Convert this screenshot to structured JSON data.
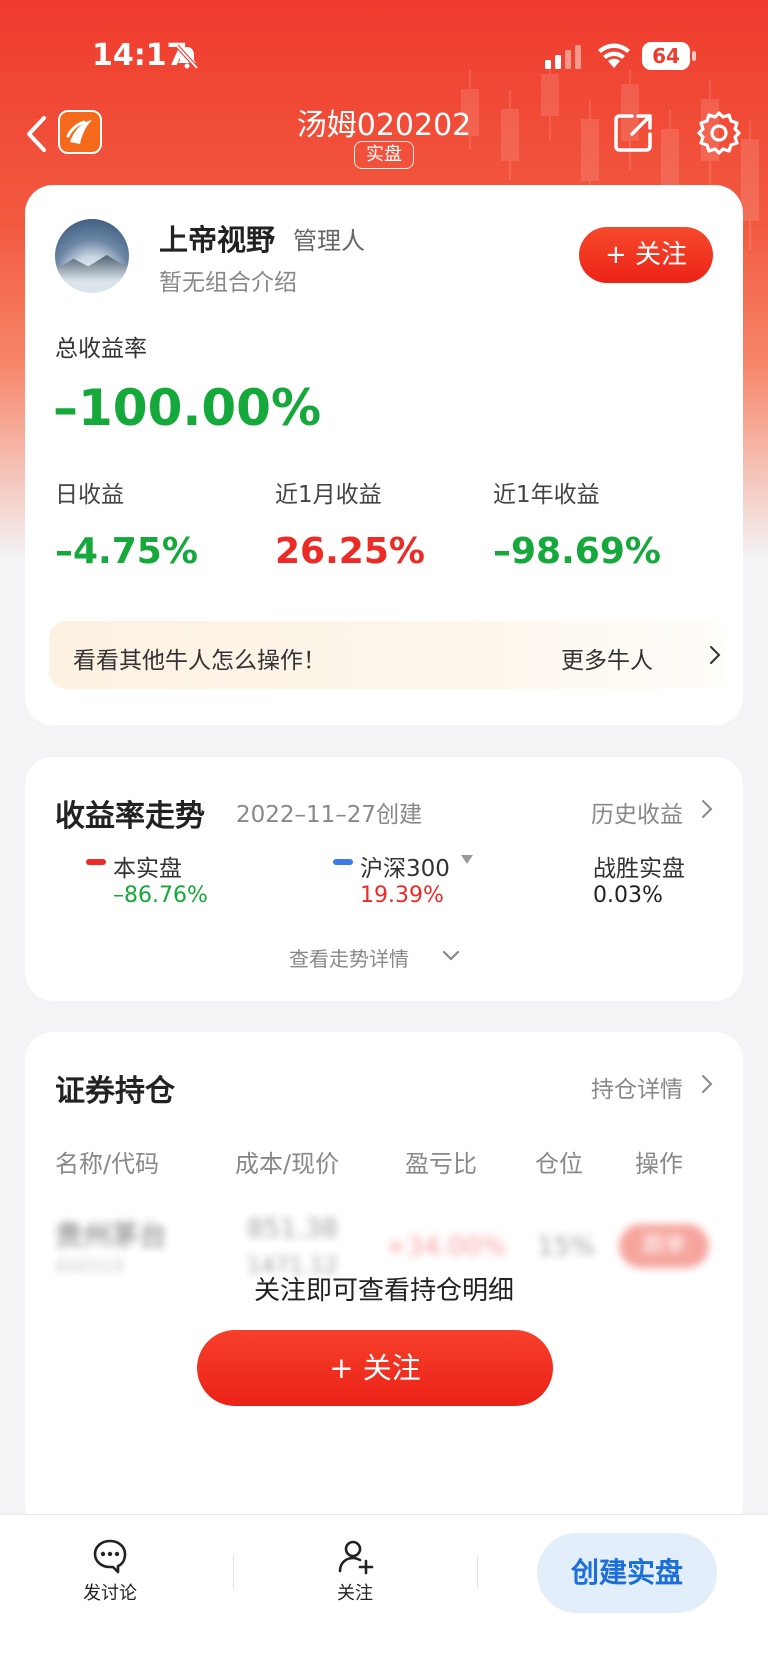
{
  "status_bar": {
    "time": "14:17",
    "battery": "64"
  },
  "nav": {
    "title": "汤姆020202",
    "tag": "实盘"
  },
  "profile": {
    "name": "上帝视野",
    "role": "管理人",
    "description": "暂无组合介绍",
    "follow_label": "+ 关注",
    "total_return_label": "总收益率",
    "total_return_value": "–100.00%",
    "stats": [
      {
        "label": "日收益",
        "value": "–4.75%"
      },
      {
        "label": "近1月收益",
        "value": "26.25%"
      },
      {
        "label": "近1年收益",
        "value": "–98.69%"
      }
    ],
    "promo_text": "看看其他牛人怎么操作！",
    "promo_more": "更多牛人"
  },
  "trend": {
    "title": "收益率走势",
    "created": "2022–11–27创建",
    "history_link": "历史收益",
    "legend": [
      {
        "name": "本实盘",
        "value": "–86.76%",
        "color": "#ec2b26"
      },
      {
        "name": "沪深300",
        "value": "19.39%",
        "color": "#3b7be8"
      },
      {
        "name": "战胜实盘",
        "value": "0.03%"
      }
    ],
    "detail_link": "查看走势详情"
  },
  "holdings": {
    "title": "证券持仓",
    "detail_link": "持仓详情",
    "columns": [
      "名称/代码",
      "成本/现价",
      "盈亏比",
      "仓位",
      "操作"
    ],
    "blurred_row": {
      "name": "贵州茅台",
      "code": "600519",
      "cost": "851.38",
      "price": "1471.12",
      "ratio": "+34.00%",
      "position": "15%",
      "action": "跟单"
    },
    "notice": "关注即可查看持仓明细",
    "follow_label": "+ 关注"
  },
  "bottom_bar": {
    "discuss_label": "发讨论",
    "follow_label": "关注",
    "create_label": "创建实盘"
  },
  "colors": {
    "brand_red": "#ef3b2d",
    "gain_red": "#ec2b26",
    "loss_green": "#15a83a",
    "accent_blue": "#1c6fd9"
  }
}
